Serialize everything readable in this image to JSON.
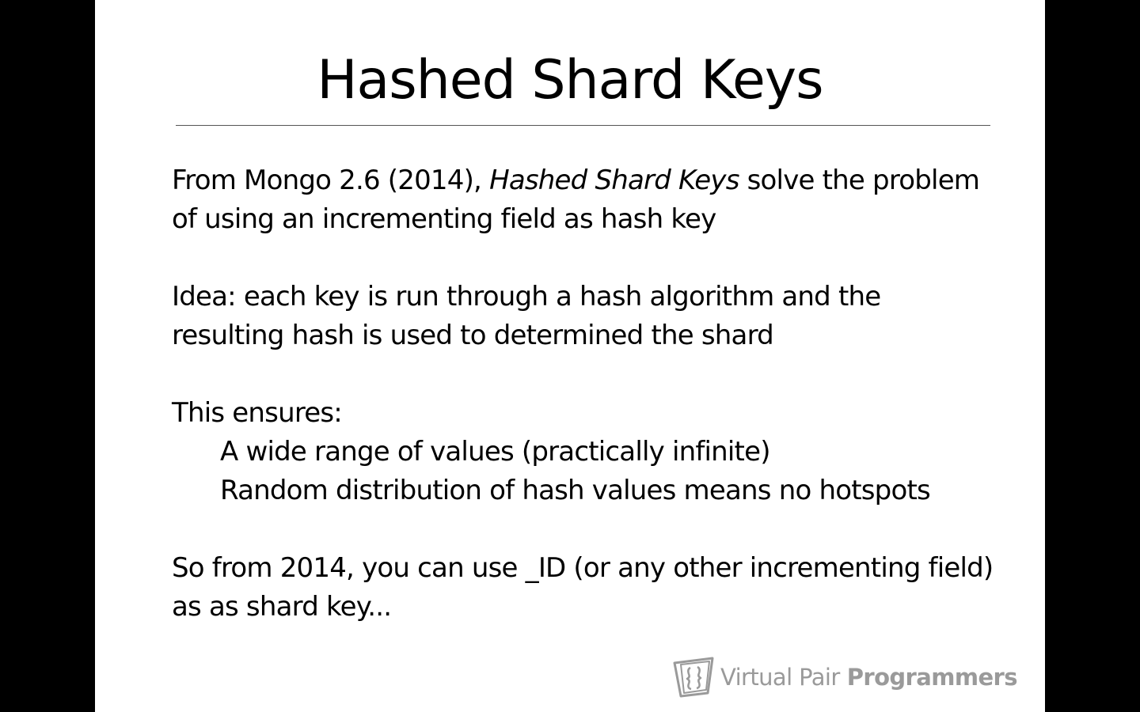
{
  "slide": {
    "title": "Hashed Shard Keys",
    "paragraph1": {
      "prefix": "From Mongo 2.6 (2014), ",
      "emphasis": "Hashed Shard Keys",
      "suffix": " solve the problem of using an incrementing field as hash key"
    },
    "paragraph2": "Idea: each key is run through a hash algorithm and the resulting hash is used to determined the shard",
    "paragraph3": {
      "lead": "This ensures:",
      "items": [
        "A wide range of values (practically infinite)",
        "Random distribution of hash values means no hotspots"
      ]
    },
    "paragraph4": "So from 2014, you can use _ID (or any other incrementing field) as as shard key..."
  },
  "logo": {
    "icon": "vpp-logo-icon",
    "text_light": "Virtual Pair",
    "text_bold": "Programmers"
  },
  "colors": {
    "background": "#000000",
    "slide": "#ffffff",
    "text": "#000000",
    "logo": "#9a9a9a"
  }
}
